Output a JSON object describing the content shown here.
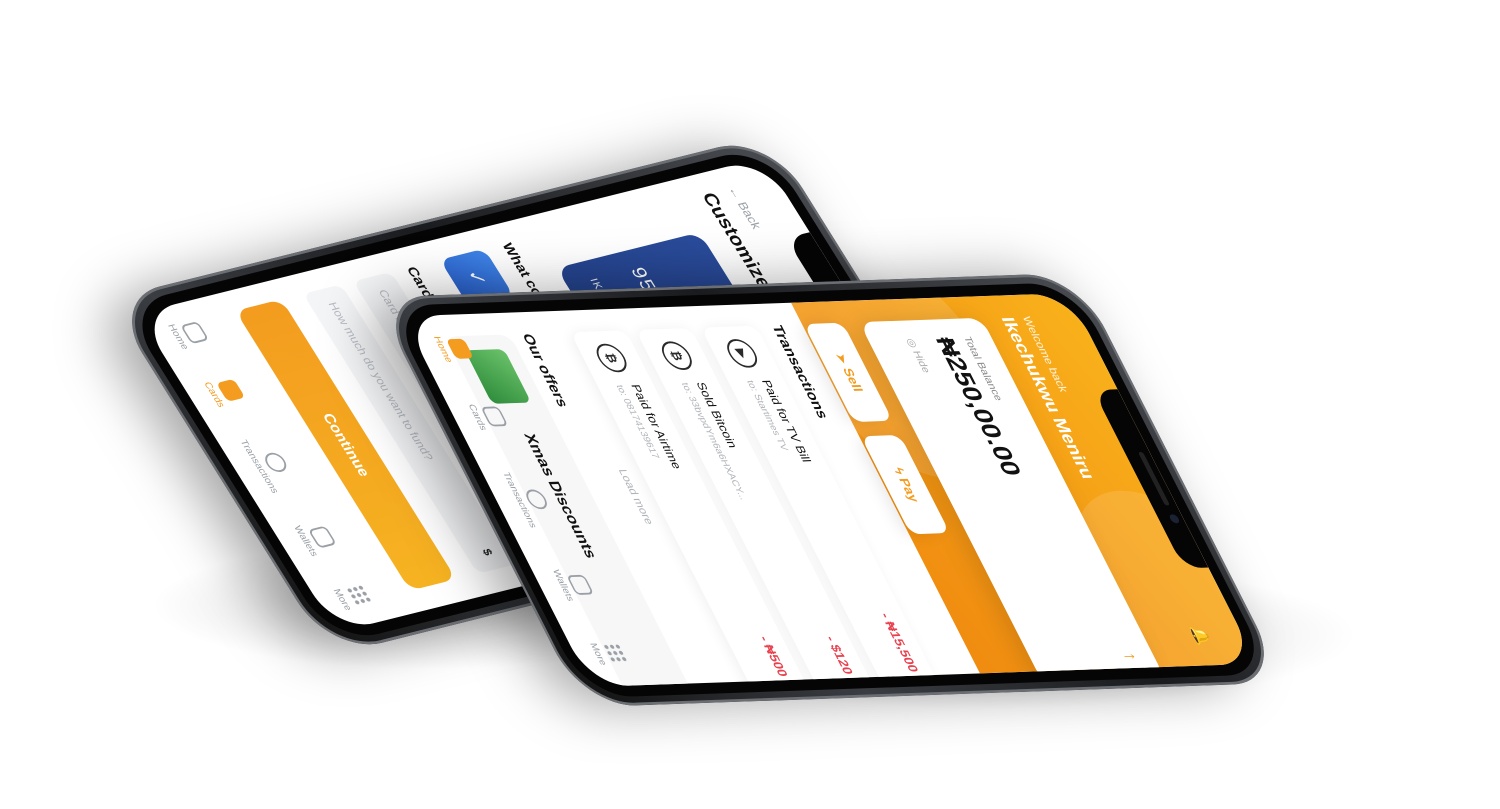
{
  "colors": {
    "accent": "#f39c1f",
    "negative": "#e8424f",
    "card_blue": "#2a4c9c"
  },
  "phone_back": {
    "back_label": "Back",
    "title": "Customize",
    "card": {
      "number": "95",
      "holder": "IKEC"
    },
    "colour_question": "What colour",
    "card_details_heading": "Card details",
    "card_label_placeholder": "Card label",
    "fund_placeholder": "How much do you want to fund?",
    "currency_symbol": "$",
    "continue_label": "Continue",
    "nav": [
      {
        "label": "Home",
        "icon": "home-icon"
      },
      {
        "label": "Cards",
        "icon": "card-icon",
        "active": true
      },
      {
        "label": "Transactions",
        "icon": "pie-chart-icon"
      },
      {
        "label": "Wallets",
        "icon": "wallet-icon"
      },
      {
        "label": "More",
        "icon": "grid-icon"
      }
    ]
  },
  "phone_front": {
    "welcome": "Welcome back",
    "user_name": "Ikechukwu Meniru",
    "balance_label": "Total Balance",
    "balance_value": "₦250,00.00",
    "hide_label": "Hide",
    "actions": {
      "sell": "Sell",
      "pay": "Pay"
    },
    "transactions_heading": "Transactions",
    "transactions": [
      {
        "title": "Paid for TV Bill",
        "sub": "to: Startimes TV",
        "amount": "- ₦15,500",
        "icon": "tv-icon"
      },
      {
        "title": "Sold Bitcoin",
        "sub": "to: 33bvpdYm6a6HXACY...",
        "amount": "- $120",
        "icon": "bitcoin-icon"
      },
      {
        "title": "Paid for Airtime",
        "sub": "to: 08174139617",
        "amount": "- ₦500",
        "icon": "bitcoin-icon"
      }
    ],
    "load_more": "Load more",
    "offers_heading": "Our offers",
    "offer_title": "Xmas Discounts",
    "nav": [
      {
        "label": "Home",
        "icon": "home-icon",
        "active": true
      },
      {
        "label": "Cards",
        "icon": "card-icon"
      },
      {
        "label": "Transactions",
        "icon": "pie-chart-icon"
      },
      {
        "label": "Wallets",
        "icon": "wallet-icon"
      },
      {
        "label": "More",
        "icon": "grid-icon"
      }
    ]
  }
}
